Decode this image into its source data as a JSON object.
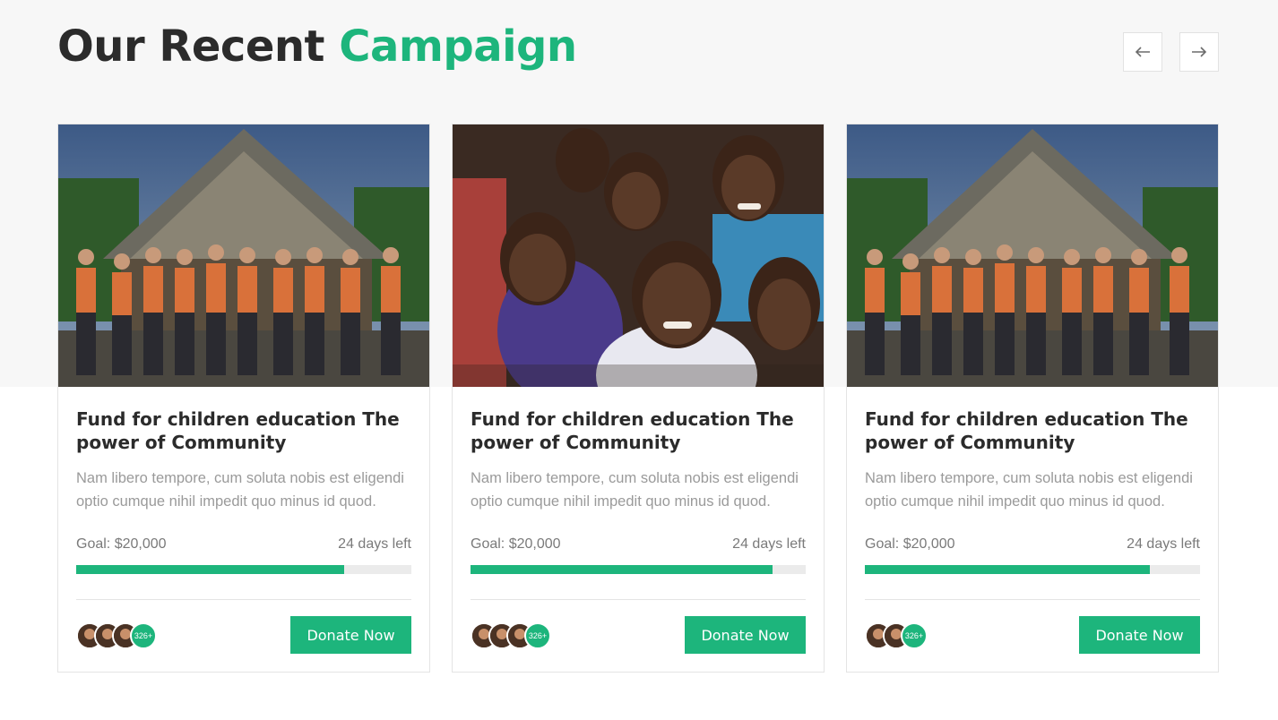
{
  "header": {
    "title_main": "Our Recent",
    "title_accent": "Campaign",
    "prev_icon": "arrow-left-icon",
    "next_icon": "arrow-right-icon"
  },
  "colors": {
    "accent": "#1db57c",
    "heading": "#2b2b2b",
    "muted": "#9a9a9a"
  },
  "campaigns": [
    {
      "image": "volunteer-group-photo",
      "title": "Fund for children education The power of Community",
      "description": "Nam libero tempore, cum soluta nobis est eligendi optio cumque nihil impedit quo minus id quod.",
      "goal": "Goal: $20,000",
      "days_left": "24 days left",
      "progress": 0.8,
      "donor_count": "326+",
      "donate_label": "Donate Now"
    },
    {
      "image": "smiling-children-photo",
      "title": "Fund for children education The power of Community",
      "description": "Nam libero tempore, cum soluta nobis est eligendi optio cumque nihil impedit quo minus id quod.",
      "goal": "Goal: $20,000",
      "days_left": "24 days left",
      "progress": 0.9,
      "donor_count": "326+",
      "donate_label": "Donate Now"
    },
    {
      "image": "volunteer-group-photo",
      "title": "Fund for children education The power of Community",
      "description": "Nam libero tempore, cum soluta nobis est eligendi optio cumque nihil impedit quo minus id quod.",
      "goal": "Goal: $20,000",
      "days_left": "24 days left",
      "progress": 0.85,
      "donor_count": "326+",
      "donate_label": "Donate Now"
    }
  ]
}
